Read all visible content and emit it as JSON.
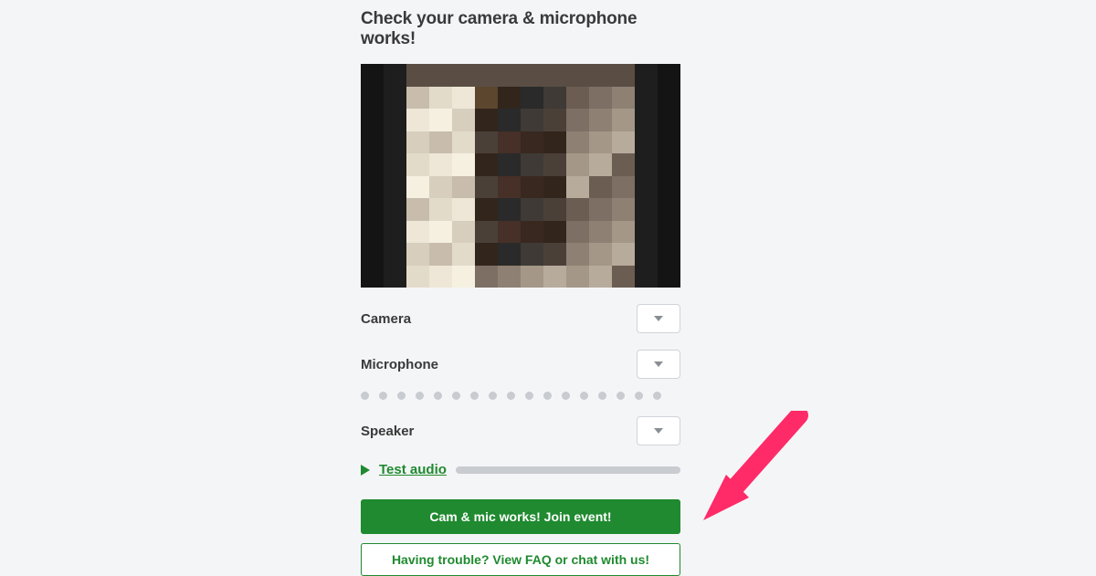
{
  "title": "Check your camera & microphone works!",
  "accent": "#1f8a2f",
  "controls": {
    "camera_label": "Camera",
    "microphone_label": "Microphone",
    "speaker_label": "Speaker",
    "test_audio_label": "Test audio"
  },
  "mic_level_dots": 17,
  "buttons": {
    "join_event": "Cam & mic works! Join event!",
    "help": "Having trouble? View FAQ or chat with us!"
  },
  "annotation": {
    "arrow_color": "#ff2a68",
    "points_to": "join-event-button"
  },
  "mosaic_palette": [
    "#2a2a2a",
    "#3f3a35",
    "#4b4038",
    "#5a4e44",
    "#6b5d52",
    "#7d6f63",
    "#8e8073",
    "#a49788",
    "#b7ab9c",
    "#c8bdad",
    "#d7cebd",
    "#e3dbca",
    "#eee7d7",
    "#f6f0e1",
    "#1e1e1e",
    "#141414",
    "#0d0d0d",
    "#463028",
    "#382820",
    "#5c462e",
    "#32251c"
  ]
}
